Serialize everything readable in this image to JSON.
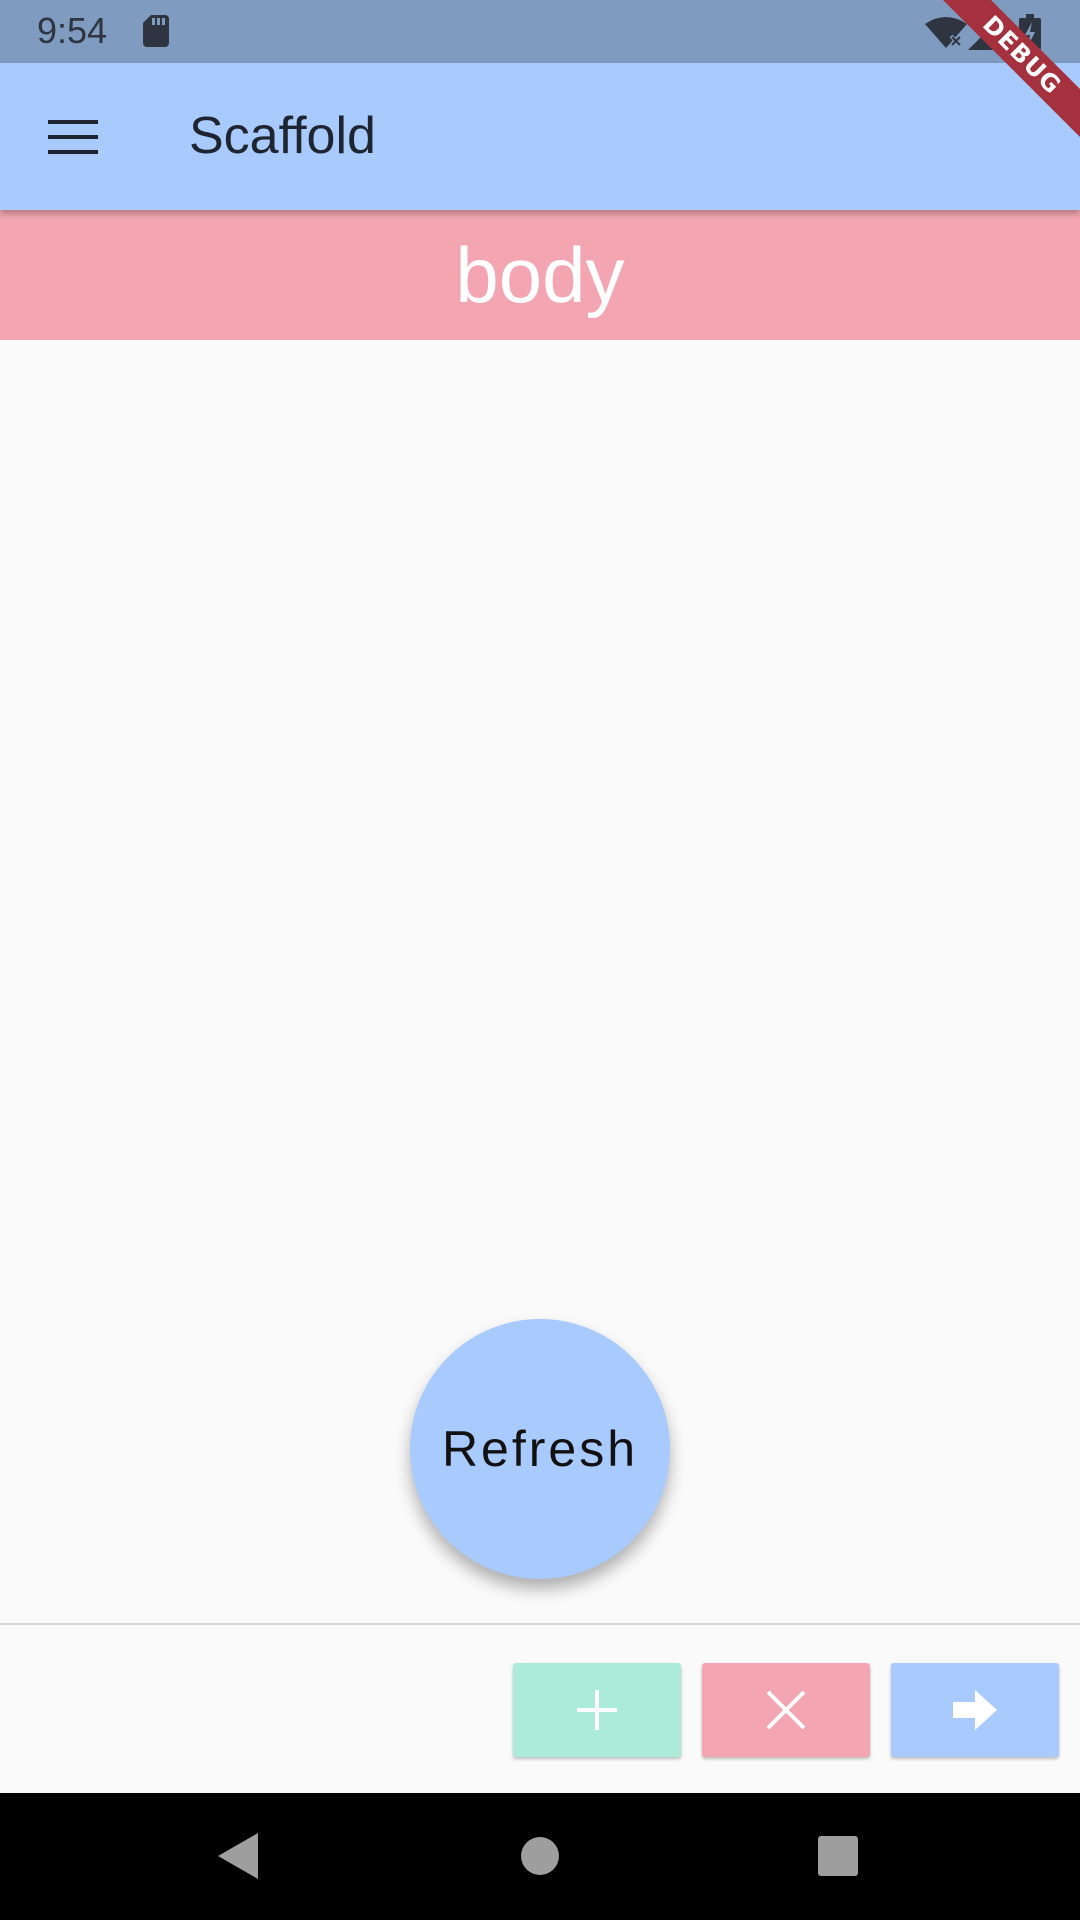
{
  "status_bar": {
    "time": "9:54",
    "icons": [
      "sd-card-icon",
      "wifi-off-icon",
      "signal-icon",
      "battery-charging-icon"
    ]
  },
  "debug_banner": {
    "label": "DEBUG"
  },
  "app_bar": {
    "title": "Scaffold",
    "leading_icon": "menu-icon",
    "color": "#A8CAFD"
  },
  "body": {
    "label": "body",
    "color": "#F3A5B1"
  },
  "fab": {
    "label": "Refresh",
    "color": "#A8CAFD"
  },
  "footer_buttons": [
    {
      "icon": "add-icon",
      "color": "#ACEBD8"
    },
    {
      "icon": "close-icon",
      "color": "#F3A5B1"
    },
    {
      "icon": "arrow-forward-icon",
      "color": "#A8CAFD"
    }
  ],
  "nav_bar": {
    "icons": [
      "back-icon",
      "home-icon",
      "recents-icon"
    ]
  }
}
